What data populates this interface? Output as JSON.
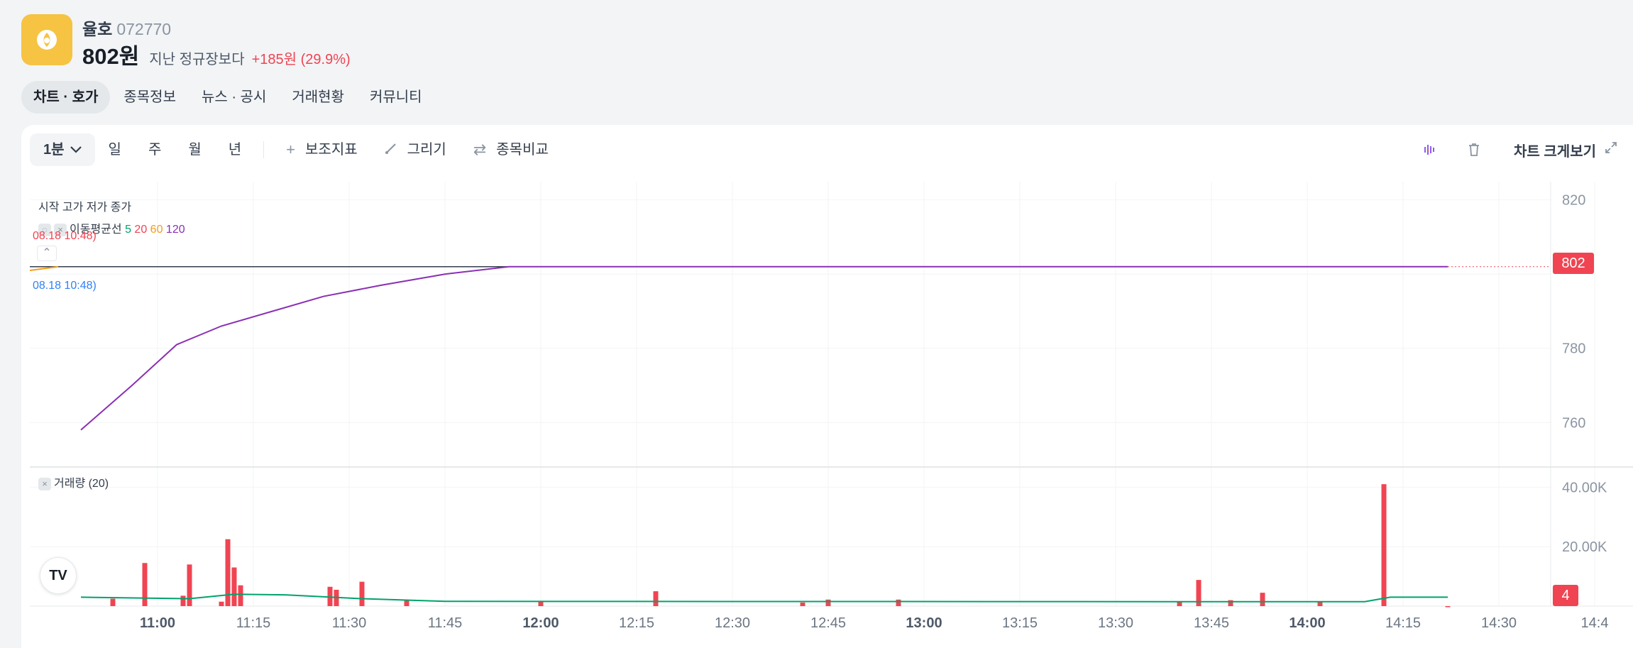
{
  "stock": {
    "name": "율호",
    "code": "072770",
    "price": "802원",
    "vs_label": "지난 정규장보다",
    "change": "+185원 (29.9%)",
    "logo_icon": "yulho-logo-icon",
    "logo_color": "#f6c343"
  },
  "tabs": [
    {
      "label": "차트 · 호가",
      "active": true
    },
    {
      "label": "종목정보"
    },
    {
      "label": "뉴스 · 공시"
    },
    {
      "label": "거래현황"
    },
    {
      "label": "커뮤니티"
    }
  ],
  "toolbar": {
    "interval": "1분",
    "periods": [
      "일",
      "주",
      "월",
      "년"
    ],
    "indicator_label": "보조지표",
    "draw_label": "그리기",
    "compare_label": "종목비교",
    "expand_label": "차트 크게보기"
  },
  "chart": {
    "ohlc_legend": "시작 고가 저가 종가",
    "ma_label": "이동평균선",
    "ma_periods": [
      "5",
      "20",
      "60",
      "120"
    ],
    "ma_colors": [
      "#00a36c",
      "#f04452",
      "#f59c1a",
      "#8a2fb4"
    ],
    "high_marker": "08.18 10:48)",
    "low_marker": "08.18 10:48)",
    "current_price": "802",
    "volume_label": "거래량 (20)",
    "volume_last": "4",
    "up_color": "#f04452",
    "tv_logo": "TV"
  },
  "chart_data": {
    "type": "line",
    "price_axis": {
      "ticks": [
        "820",
        "780",
        "760"
      ],
      "range": [
        748,
        823
      ]
    },
    "volume_axis": {
      "ticks": [
        "40.00K",
        "20.00K"
      ],
      "range": [
        0,
        42000
      ]
    },
    "time_axis": [
      "11:00",
      "11:15",
      "11:30",
      "11:45",
      "12:00",
      "12:15",
      "12:30",
      "12:45",
      "13:00",
      "13:15",
      "13:30",
      "13:45",
      "14:00",
      "14:15",
      "14:30",
      "14:4"
    ],
    "time_axis_bold": [
      "11:00",
      "12:00",
      "13:00",
      "14:00"
    ],
    "price_close": 802,
    "ma120": [
      {
        "t": "10:48",
        "v": 758
      },
      {
        "t": "10:56",
        "v": 770
      },
      {
        "t": "11:03",
        "v": 781
      },
      {
        "t": "11:10",
        "v": 786
      },
      {
        "t": "11:18",
        "v": 790
      },
      {
        "t": "11:26",
        "v": 794
      },
      {
        "t": "11:35",
        "v": 797
      },
      {
        "t": "11:45",
        "v": 800
      },
      {
        "t": "11:55",
        "v": 802
      },
      {
        "t": "14:22",
        "v": 802
      }
    ],
    "volume_bars": [
      {
        "t": "10:53",
        "v": 2500
      },
      {
        "t": "10:58",
        "v": 14500
      },
      {
        "t": "11:04",
        "v": 3500
      },
      {
        "t": "11:05",
        "v": 14000
      },
      {
        "t": "11:10",
        "v": 1500
      },
      {
        "t": "11:11",
        "v": 22500
      },
      {
        "t": "11:12",
        "v": 13000
      },
      {
        "t": "11:13",
        "v": 7000
      },
      {
        "t": "11:27",
        "v": 6500
      },
      {
        "t": "11:28",
        "v": 5500
      },
      {
        "t": "11:32",
        "v": 8200
      },
      {
        "t": "11:39",
        "v": 1800
      },
      {
        "t": "12:00",
        "v": 1600
      },
      {
        "t": "12:18",
        "v": 5000
      },
      {
        "t": "12:41",
        "v": 1200
      },
      {
        "t": "12:45",
        "v": 2200
      },
      {
        "t": "12:56",
        "v": 2200
      },
      {
        "t": "13:40",
        "v": 1500
      },
      {
        "t": "13:43",
        "v": 8800
      },
      {
        "t": "13:48",
        "v": 2000
      },
      {
        "t": "13:53",
        "v": 4500
      },
      {
        "t": "14:02",
        "v": 1500
      },
      {
        "t": "14:12",
        "v": 41000
      },
      {
        "t": "14:22",
        "v": 4
      }
    ],
    "volume_ma": [
      {
        "t": "10:48",
        "v": 3000
      },
      {
        "t": "11:05",
        "v": 2500
      },
      {
        "t": "11:12",
        "v": 4000
      },
      {
        "t": "11:20",
        "v": 3800
      },
      {
        "t": "11:32",
        "v": 2500
      },
      {
        "t": "11:45",
        "v": 1600
      },
      {
        "t": "13:45",
        "v": 1500
      },
      {
        "t": "14:09",
        "v": 1500
      },
      {
        "t": "14:13",
        "v": 3000
      },
      {
        "t": "14:22",
        "v": 3000
      }
    ]
  }
}
